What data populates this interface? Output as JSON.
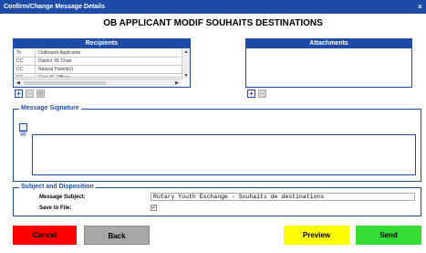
{
  "window": {
    "title": "Confirm/Change Message Details",
    "close": "×"
  },
  "main_title": "OB APPLICANT MODIF SOUHAITS DESTINATIONS",
  "recipients": {
    "header": "Recipients",
    "rows": [
      {
        "type": "To",
        "name": "Outbound Applicants"
      },
      {
        "type": "CC",
        "name": "District YE Chair"
      },
      {
        "type": "CC",
        "name": "Natural Parent(s)"
      },
      {
        "type": "CC",
        "name": "Club YE Officer"
      }
    ]
  },
  "attachments": {
    "header": "Attachments"
  },
  "controls": {
    "add": "+",
    "remove": "−",
    "edit": "▤"
  },
  "signature": {
    "legend": "Message Signature"
  },
  "subject": {
    "legend": "Subject and Disposition",
    "subject_label": "Message Subject:",
    "subject_value": "Rotary Youth Exchange - Souhaits de destinations",
    "save_label": "Save to File:",
    "save_checked": "✓"
  },
  "buttons": {
    "cancel": "Cancel",
    "back": "Back",
    "preview": "Preview",
    "send": "Send"
  },
  "colors": {
    "accent": "#1d4ba7",
    "cancel": "#ff0000",
    "back": "#a8a8a8",
    "preview": "#ffff00",
    "send": "#33dd33"
  }
}
